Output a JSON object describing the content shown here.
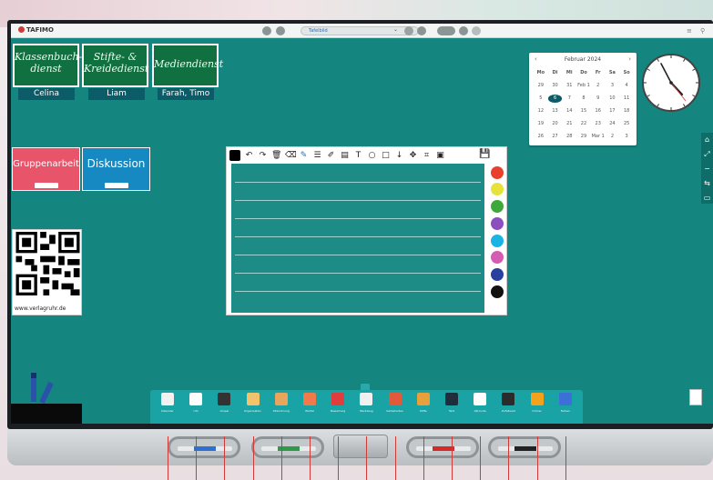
{
  "topbar": {
    "logo": "TAFIMO",
    "selector_value": "Tafelbild"
  },
  "duty_cards": [
    {
      "title": "Klassenbuch-\ndienst",
      "name": "Celina"
    },
    {
      "title": "Stifte- &\nKreidedienst",
      "name": "Liam"
    },
    {
      "title": "Mediendienst",
      "name": "Farah, Timo"
    }
  ],
  "tiles": [
    {
      "label": "Gruppenarbeit",
      "color": "#e8546a"
    },
    {
      "label": "Diskussion",
      "color": "#1789c2"
    }
  ],
  "qr": {
    "url": "www.verlagruhr.de"
  },
  "calendar": {
    "month": "Februar 2024",
    "weekdays": [
      "Mo",
      "Di",
      "Mi",
      "Do",
      "Fr",
      "Sa",
      "So"
    ],
    "rows": [
      [
        "29",
        "30",
        "31",
        "Feb 1",
        "2",
        "3",
        "4"
      ],
      [
        "5",
        "6",
        "7",
        "8",
        "9",
        "10",
        "11"
      ],
      [
        "12",
        "13",
        "14",
        "15",
        "16",
        "17",
        "18"
      ],
      [
        "19",
        "20",
        "21",
        "22",
        "23",
        "24",
        "25"
      ],
      [
        "26",
        "27",
        "28",
        "29",
        "Mar 1",
        "2",
        "3"
      ]
    ],
    "today": "6"
  },
  "board": {
    "palette": [
      "#e8402d",
      "#e6e23a",
      "#3fa83a",
      "#8c4fbf",
      "#19b4e3",
      "#d65bb3",
      "#2a3f9e",
      "#111111"
    ],
    "line_count": 7
  },
  "tray": [
    {
      "label": "Kalender",
      "color": "#f2f2f2"
    },
    {
      "label": "Uhr",
      "color": "#ffffff"
    },
    {
      "label": "Ampel",
      "color": "#333333"
    },
    {
      "label": "Organisation",
      "color": "#f2c36b"
    },
    {
      "label": "Sitzordnung",
      "color": "#e7a65b"
    },
    {
      "label": "Würfel",
      "color": "#f07a4a"
    },
    {
      "label": "Bewertung",
      "color": "#e23c3c"
    },
    {
      "label": "Werkzeug",
      "color": "#f0f0f0"
    },
    {
      "label": "Karteikarten",
      "color": "#e25a3a"
    },
    {
      "label": "Stifte",
      "color": "#e8a03a"
    },
    {
      "label": "Text",
      "color": "#1f2e3a"
    },
    {
      "label": "QR-Code",
      "color": "#ffffff"
    },
    {
      "label": "Zufallsrad",
      "color": "#2b2b2b"
    },
    {
      "label": "Ordner",
      "color": "#f4a11b"
    },
    {
      "label": "Farben",
      "color": "#3c6fd8"
    }
  ],
  "ledge_pens": [
    "#2f6fd1",
    "#2e9a48",
    "#d62a2a",
    "#222222"
  ]
}
